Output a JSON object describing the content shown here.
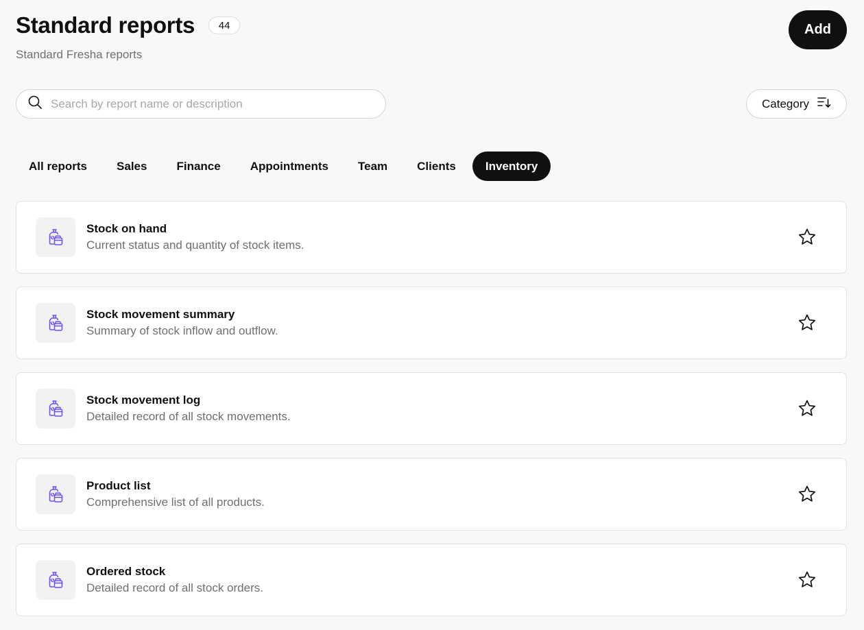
{
  "header": {
    "title": "Standard reports",
    "count": "44",
    "subtitle": "Standard Fresha reports",
    "add_label": "Add"
  },
  "search": {
    "placeholder": "Search by report name or description",
    "value": "",
    "icon": "search-icon"
  },
  "category_filter": {
    "label": "Category",
    "icon": "sort-icon"
  },
  "tabs": [
    {
      "label": "All reports",
      "active": false
    },
    {
      "label": "Sales",
      "active": false
    },
    {
      "label": "Finance",
      "active": false
    },
    {
      "label": "Appointments",
      "active": false
    },
    {
      "label": "Team",
      "active": false
    },
    {
      "label": "Clients",
      "active": false
    },
    {
      "label": "Inventory",
      "active": true
    }
  ],
  "reports": [
    {
      "title": "Stock on hand",
      "description": "Current status and quantity of stock items.",
      "icon": "inventory-icon",
      "favorite": false
    },
    {
      "title": "Stock movement summary",
      "description": "Summary of stock inflow and outflow.",
      "icon": "inventory-icon",
      "favorite": false
    },
    {
      "title": "Stock movement log",
      "description": "Detailed record of all stock movements.",
      "icon": "inventory-icon",
      "favorite": false
    },
    {
      "title": "Product list",
      "description": "Comprehensive list of all products.",
      "icon": "inventory-icon",
      "favorite": false
    },
    {
      "title": "Ordered stock",
      "description": "Detailed record of all stock orders.",
      "icon": "inventory-icon",
      "favorite": false
    }
  ],
  "colors": {
    "accent_dark": "#101010",
    "inventory_icon": "#6950f3",
    "background": "#f8f8f8"
  }
}
